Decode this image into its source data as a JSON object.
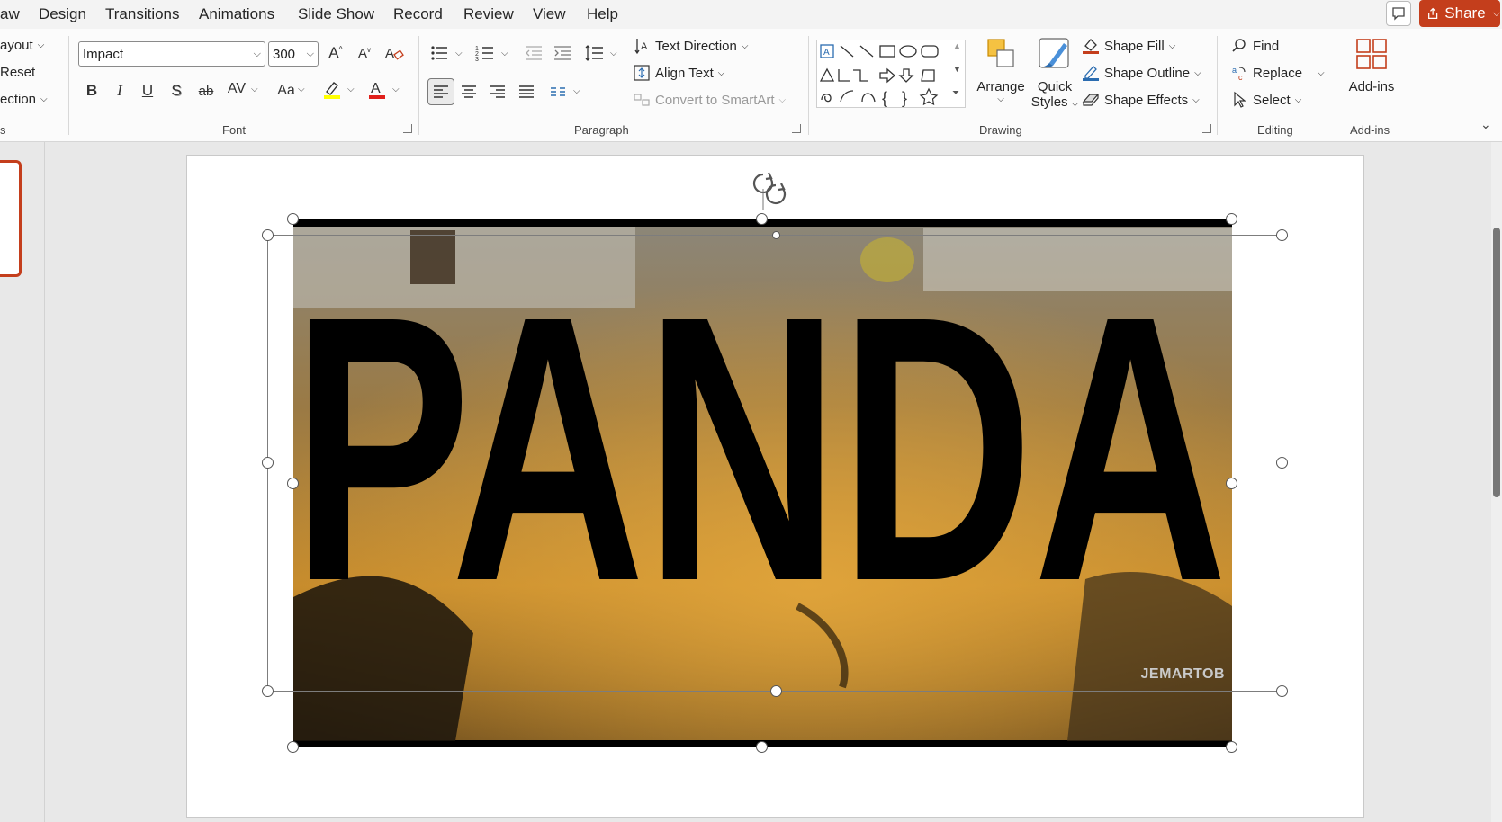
{
  "menu": {
    "items": [
      "aw",
      "Design",
      "Transitions",
      "Animations",
      "Slide Show",
      "Record",
      "Review",
      "View",
      "Help"
    ],
    "share_label": "Share"
  },
  "slides_group": {
    "layout_label": "ayout",
    "reset_label": "Reset",
    "section_label": "ection",
    "group_label_fragment": "s"
  },
  "font_group": {
    "font_name": "Impact",
    "font_size": "300",
    "group_label": "Font"
  },
  "paragraph_group": {
    "text_direction_label": "Text Direction",
    "align_text_label": "Align Text",
    "convert_smartart_label": "Convert to SmartArt",
    "group_label": "Paragraph"
  },
  "drawing_group": {
    "arrange_label": "Arrange",
    "quick_styles_line1": "Quick",
    "quick_styles_line2": "Styles",
    "shape_fill_label": "Shape Fill",
    "shape_outline_label": "Shape Outline",
    "shape_effects_label": "Shape Effects",
    "group_label": "Drawing"
  },
  "editing_group": {
    "find_label": "Find",
    "replace_label": "Replace",
    "select_label": "Select",
    "group_label": "Editing"
  },
  "addins_group": {
    "addins_label": "Add-ins",
    "group_label": "Add-ins"
  },
  "slide": {
    "headline_text": "PANDA",
    "watermark_text": "JEMARTOB"
  },
  "colors": {
    "accent": "#c43e1c",
    "highlight": "#ffff00",
    "font_color": "#e0201b",
    "ribbon_bg": "#fbfbfb"
  }
}
